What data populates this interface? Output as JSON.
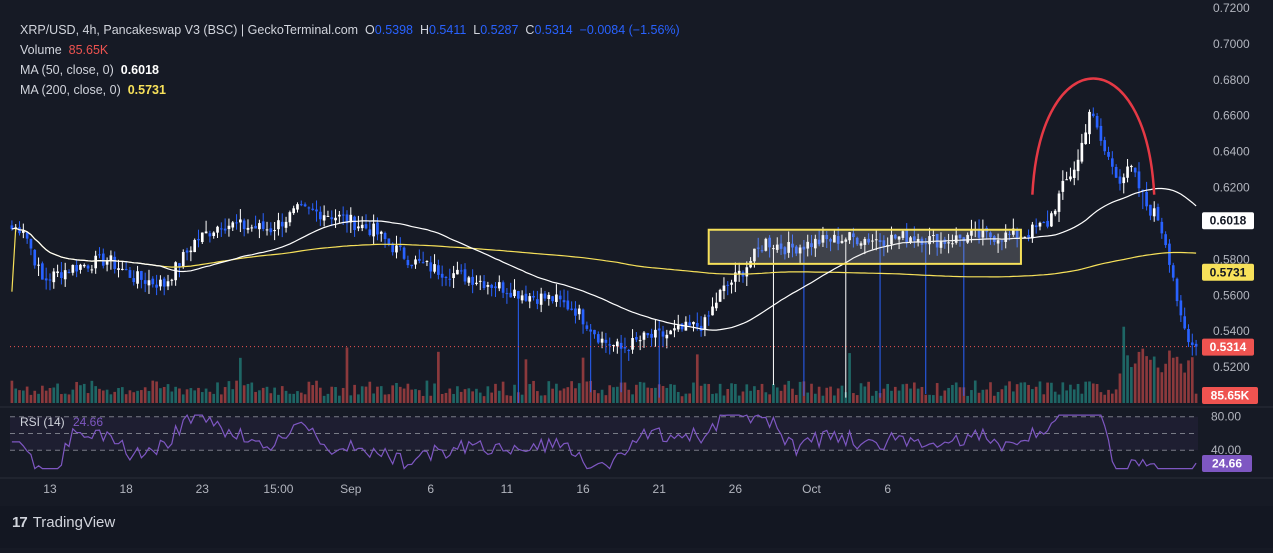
{
  "header": {
    "symbol": "XRP/USD, 4h, Pancakeswap V3 (BSC) | GeckoTerminal.com",
    "o_label": "O",
    "o_value": "0.5398",
    "h_label": "H",
    "h_value": "0.5411",
    "l_label": "L",
    "l_value": "0.5287",
    "c_label": "C",
    "c_value": "0.5314",
    "change": "−0.0084 (−1.56%)",
    "volume_label": "Volume",
    "volume_value": "85.65K",
    "ma50_label": "MA (50, close, 0)",
    "ma50_value": "0.6018",
    "ma200_label": "MA (200, close, 0)",
    "ma200_value": "0.5731"
  },
  "rsi": {
    "label": "RSI (14)",
    "value": "24.66",
    "levels": [
      "80.00",
      "40.00"
    ]
  },
  "branding": {
    "logo_text": "TradingView",
    "logo_mark": "17"
  },
  "colors": {
    "up": "#ffffff",
    "down": "#2962ff",
    "ma50": "#ffffff",
    "ma200": "#f7e15a",
    "rsi": "#7e57c2",
    "vol_up": "#26a69a",
    "vol_down": "#ef5350",
    "annotation": "#e53945",
    "box": "#f7e15a",
    "price_line": "#ef5350"
  },
  "chart_data": {
    "type": "candlestick",
    "title": "XRP/USD, 4h, Pancakeswap V3 (BSC) | GeckoTerminal.com",
    "ylim": [
      0.5,
      0.72
    ],
    "y_ticks": [
      "0.7200",
      "0.7000",
      "0.6800",
      "0.6600",
      "0.6400",
      "0.6200",
      "0.5800",
      "0.5600",
      "0.5400",
      "0.5200"
    ],
    "x_ticks": [
      "13",
      "18",
      "23",
      "15:00",
      "Sep",
      "6",
      "11",
      "16",
      "21",
      "26",
      "Oct",
      "6"
    ],
    "close_anchors": [
      [
        0,
        0.597
      ],
      [
        3,
        0.598
      ],
      [
        8,
        0.568
      ],
      [
        15,
        0.575
      ],
      [
        25,
        0.58
      ],
      [
        32,
        0.57
      ],
      [
        40,
        0.566
      ],
      [
        48,
        0.59
      ],
      [
        55,
        0.6
      ],
      [
        62,
        0.598
      ],
      [
        68,
        0.597
      ],
      [
        75,
        0.607
      ],
      [
        82,
        0.606
      ],
      [
        88,
        0.602
      ],
      [
        95,
        0.596
      ],
      [
        100,
        0.587
      ],
      [
        105,
        0.579
      ],
      [
        112,
        0.574
      ],
      [
        120,
        0.57
      ],
      [
        128,
        0.565
      ],
      [
        135,
        0.56
      ],
      [
        142,
        0.558
      ],
      [
        148,
        0.552
      ],
      [
        155,
        0.535
      ],
      [
        160,
        0.53
      ],
      [
        166,
        0.536
      ],
      [
        172,
        0.538
      ],
      [
        178,
        0.542
      ],
      [
        182,
        0.544
      ],
      [
        186,
        0.561
      ],
      [
        192,
        0.574
      ],
      [
        198,
        0.59
      ],
      [
        204,
        0.586
      ],
      [
        212,
        0.59
      ],
      [
        220,
        0.592
      ],
      [
        228,
        0.591
      ],
      [
        236,
        0.593
      ],
      [
        244,
        0.59
      ],
      [
        252,
        0.593
      ],
      [
        260,
        0.593
      ],
      [
        266,
        0.594
      ],
      [
        272,
        0.6
      ],
      [
        276,
        0.62
      ],
      [
        280,
        0.635
      ],
      [
        283,
        0.663
      ],
      [
        287,
        0.64
      ],
      [
        291,
        0.625
      ],
      [
        294,
        0.63
      ],
      [
        298,
        0.61
      ],
      [
        301,
        0.603
      ],
      [
        303,
        0.59
      ],
      [
        305,
        0.571
      ],
      [
        307,
        0.545
      ],
      [
        309,
        0.533
      ],
      [
        311,
        0.531
      ]
    ],
    "candle_count": 312,
    "series": [
      {
        "name": "MA (50, close, 0)",
        "last": 0.6018
      },
      {
        "name": "MA (200, close, 0)",
        "last": 0.5731
      }
    ],
    "last_price": 0.5314,
    "last_volume": "85.65K",
    "rsi_last": 24.66,
    "rsi_ylim": [
      0,
      100
    ],
    "rsi_levels": [
      80,
      60,
      40
    ],
    "annotations": [
      {
        "type": "rectangle",
        "x_range": [
          183,
          265
        ],
        "y_range": [
          0.5775,
          0.5965
        ],
        "color": "#f7e15a"
      },
      {
        "type": "arc",
        "x_range": [
          268,
          300
        ],
        "peak": 0.68,
        "base": 0.616,
        "color": "#e53945"
      }
    ]
  }
}
